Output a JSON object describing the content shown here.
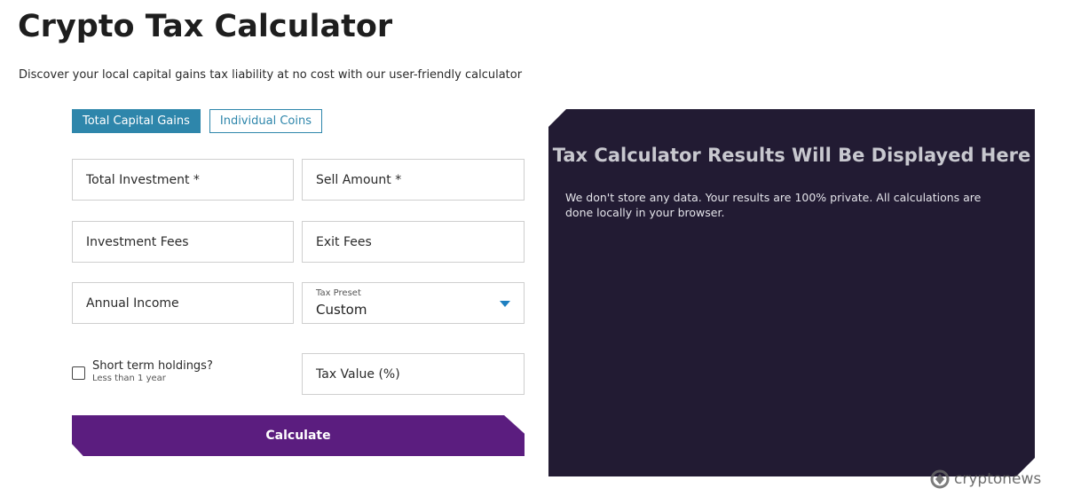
{
  "header": {
    "title": "Crypto Tax Calculator",
    "subtitle": "Discover your local capital gains tax liability at no cost with our user-friendly calculator"
  },
  "tabs": [
    {
      "label": "Total Capital Gains",
      "active": true
    },
    {
      "label": "Individual Coins",
      "active": false
    }
  ],
  "form": {
    "total_investment": "Total Investment *",
    "sell_amount": "Sell Amount *",
    "investment_fees": "Investment Fees",
    "exit_fees": "Exit Fees",
    "annual_income": "Annual Income",
    "tax_preset": {
      "label": "Tax Preset",
      "value": "Custom"
    },
    "short_term": {
      "label": "Short term holdings?",
      "sublabel": "Less than 1 year",
      "checked": false
    },
    "tax_value": "Tax Value (%)",
    "calculate_label": "Calculate"
  },
  "results": {
    "title": "Tax Calculator Results Will Be Displayed Here",
    "text": "We don't store any data. Your results are 100% private. All calculations are done locally in your browser."
  },
  "watermark": {
    "text": "cryptonews"
  },
  "colors": {
    "tab_accent": "#2e86ab",
    "button": "#5b1d7f",
    "results_bg": "#221b33",
    "caret": "#1e7fc0"
  }
}
